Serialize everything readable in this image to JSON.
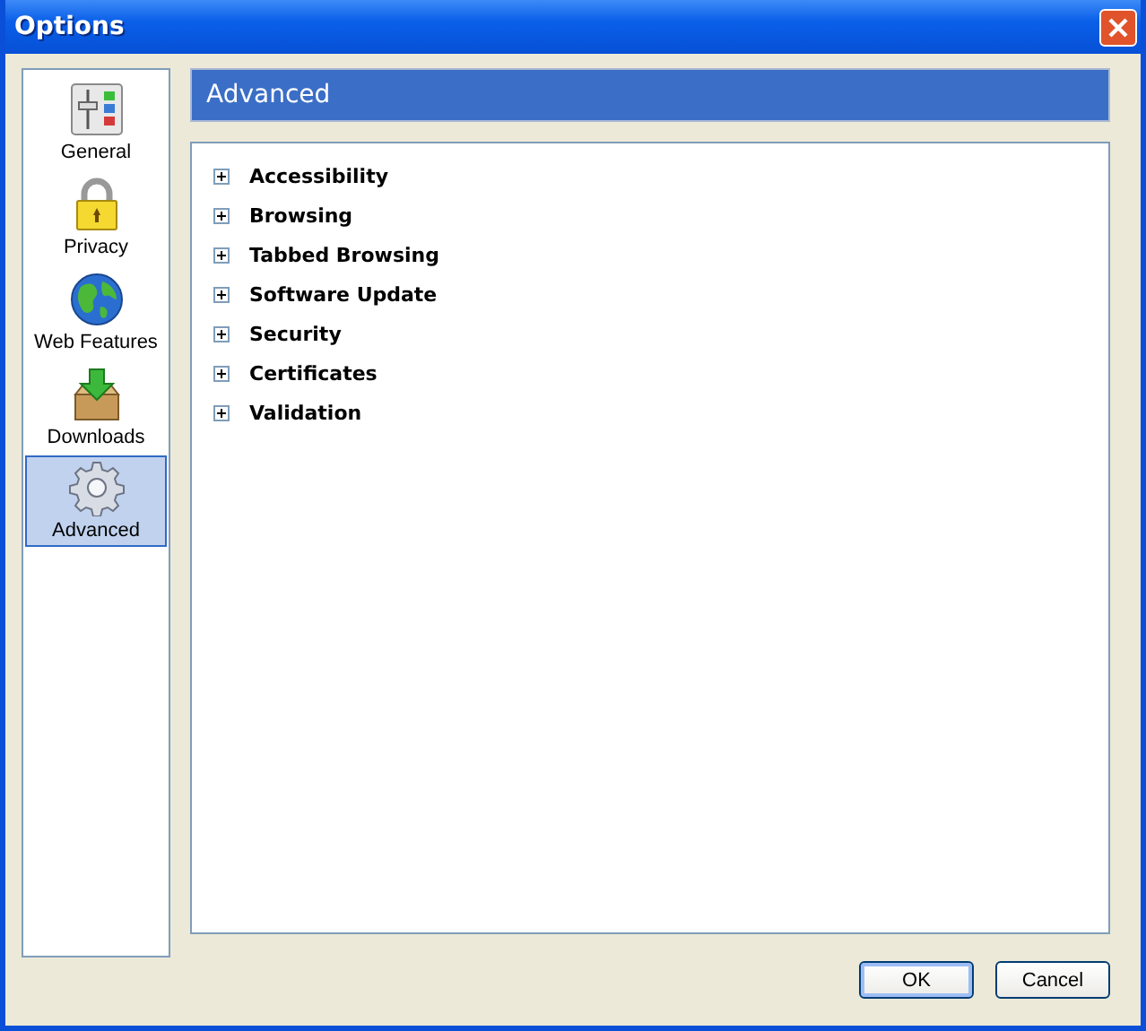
{
  "window": {
    "title": "Options"
  },
  "sidebar": {
    "items": [
      {
        "label": "General",
        "selected": false
      },
      {
        "label": "Privacy",
        "selected": false
      },
      {
        "label": "Web Features",
        "selected": false
      },
      {
        "label": "Downloads",
        "selected": false
      },
      {
        "label": "Advanced",
        "selected": true
      }
    ]
  },
  "header": {
    "title": "Advanced"
  },
  "tree": {
    "items": [
      {
        "label": "Accessibility",
        "expanded": false
      },
      {
        "label": "Browsing",
        "expanded": false
      },
      {
        "label": "Tabbed Browsing",
        "expanded": false
      },
      {
        "label": "Software Update",
        "expanded": false
      },
      {
        "label": "Security",
        "expanded": false
      },
      {
        "label": "Certificates",
        "expanded": false
      },
      {
        "label": "Validation",
        "expanded": false
      }
    ]
  },
  "buttons": [
    {
      "label": "OK",
      "default": true
    },
    {
      "label": "Cancel",
      "default": false
    }
  ]
}
